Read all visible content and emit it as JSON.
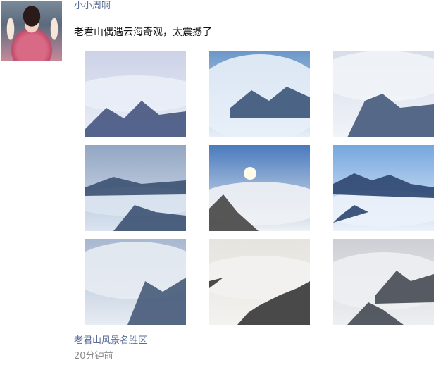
{
  "post": {
    "user_name": "小小周啊",
    "text": "老君山偶遇云海奇观，太震撼了",
    "location": "老君山风景名胜区",
    "time_ago": "20分钟前"
  },
  "images": [
    {
      "name": "sea-of-clouds-photo-1",
      "sky": "#c9cfe6",
      "cloud": "#e9edf7",
      "peak": "#3a4a78"
    },
    {
      "name": "sea-of-clouds-photo-2",
      "sky": "#5f8fc4",
      "cloud": "#e6eef8",
      "peak": "#2e4a70"
    },
    {
      "name": "sea-of-clouds-photo-3",
      "sky": "#d4dbe8",
      "cloud": "#f0f3f8",
      "peak": "#3a4f73"
    },
    {
      "name": "sea-of-clouds-photo-4",
      "sky": "#8a9fbf",
      "cloud": "#d8e2ef",
      "peak": "#2f4768"
    },
    {
      "name": "sea-of-clouds-photo-5",
      "sky": "#3a6fb8",
      "cloud": "#eef1f4",
      "peak": "#3a3a3a"
    },
    {
      "name": "sea-of-clouds-photo-6",
      "sky": "#6aa0dc",
      "cloud": "#eaf1fa",
      "peak": "#1e3a66"
    },
    {
      "name": "sea-of-clouds-photo-7",
      "sky": "#9fb2cc",
      "cloud": "#e6ebf2",
      "peak": "#3a4f70"
    },
    {
      "name": "sea-of-clouds-photo-8",
      "sky": "#e4e2dd",
      "cloud": "#f2f1ee",
      "peak": "#2a2a2a"
    },
    {
      "name": "sea-of-clouds-photo-9",
      "sky": "#c9ccd2",
      "cloud": "#eceef1",
      "peak": "#3a3f48"
    }
  ]
}
